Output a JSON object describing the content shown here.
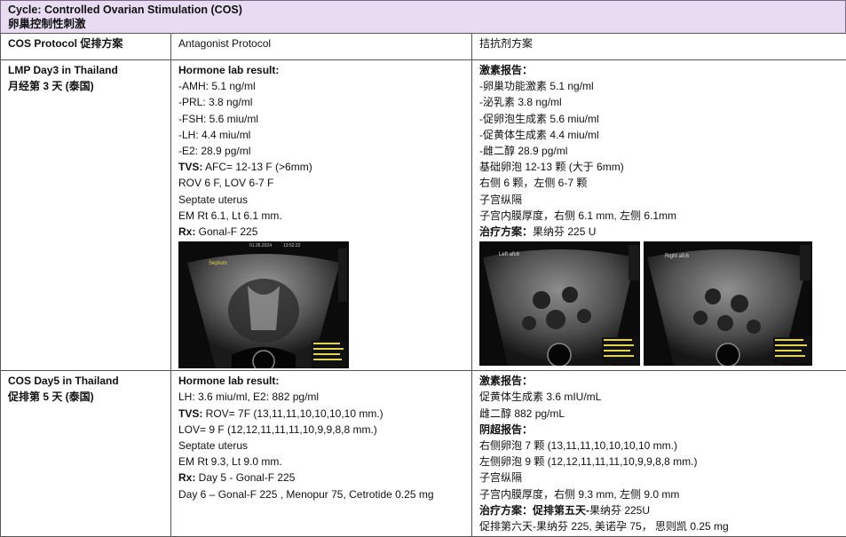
{
  "header": {
    "title_en": "Cycle: Controlled Ovarian Stimulation (COS)",
    "title_zh": "卵巢控制性刺激"
  },
  "rows": {
    "protocol": {
      "label": "COS Protocol 促排方案",
      "en": "Antagonist Protocol",
      "zh": "拮抗剂方案"
    },
    "day3": {
      "label_en": "LMP Day3 in Thailand",
      "label_zh": "月经第 3 天 (泰国)",
      "en_heading": "Hormone lab result:",
      "en_lines": [
        "-AMH: 5.1 ng/ml",
        "-PRL: 3.8 ng/ml",
        "-FSH: 5.6 miu/ml",
        "-LH: 4.4 miu/ml",
        "-E2: 28.9 pg/ml"
      ],
      "tvs_label": "TVS:",
      "tvs_text": " AFC= 12-13 F (>6mm)",
      "en_more": [
        "ROV 6 F, LOV 6-7 F",
        "Septate uterus",
        "EM Rt 6.1, Lt 6.1 mm."
      ],
      "rx_label": "Rx:",
      "rx_text": " Gonal-F 225",
      "zh_heading": "激素报告：",
      "zh_lines": [
        "-卵巢功能激素 5.1 ng/ml",
        "-泌乳素 3.8 ng/ml",
        "-促卵泡生成素 5.6 miu/ml",
        "-促黄体生成素 4.4 miu/ml",
        "-雌二醇 28.9 pg/ml",
        "基础卵泡 12-13 颗 (大于 6mm)",
        "右侧 6 颗，左侧 6-7 颗",
        "子宫纵隔",
        "子宫内膜厚度，右侧 6.1 mm, 左侧 6.1mm"
      ],
      "zh_rx_label": "治疗方案：",
      "zh_rx_text": "果纳芬 225 U",
      "us1_label": "Septum",
      "us1_date": "01.05.2024",
      "us1_time": "13:52:22",
      "us2_label": "Left afc6",
      "us3_label": "Right afc6"
    },
    "day5": {
      "label_en": "COS Day5 in Thailand",
      "label_zh": "促排第 5 天 (泰国)",
      "en_heading": "Hormone lab result:",
      "en_line1": "LH: 3.6 miu/ml, E2: 882 pg/ml",
      "tvs_label": "TVS:",
      "tvs_text": " ROV= 7F (13,11,11,10,10,10,10 mm.)",
      "en_more": [
        "LOV= 9 F (12,12,11,11,11,10,9,9,8,8 mm.)",
        "Septate uterus",
        "EM Rt 9.3, Lt 9.0 mm."
      ],
      "rx_label": "Rx:",
      "rx_text": " Day 5 - Gonal-F 225",
      "en_last": "Day 6 – Gonal-F 225 , Menopur 75, Cetrotide 0.25 mg",
      "zh_heading": "激素报告：",
      "zh_lines1": [
        "促黄体生成素 3.6 mIU/mL",
        "雌二醇 882 pg/mL"
      ],
      "zh_us_heading": "阴超报告：",
      "zh_lines2": [
        "右侧卵泡 7 颗 (13,11,11,10,10,10,10 mm.)",
        "左侧卵泡 9 颗 (12,12,11,11,11,10,9,9,8,8 mm.)",
        "子宫纵隔",
        "子宫内膜厚度，右侧 9.3 mm, 左侧 9.0 mm"
      ],
      "zh_rx_label": "治疗方案：促排第五天-",
      "zh_rx_text": "果纳芬 225U",
      "zh_last": "促排第六天-果纳芬 225, 美诺孕 75，  思则凯 0.25 mg"
    }
  },
  "colors": {
    "header_bg": "#e8dcf2",
    "ultrasound_bg": "#0b0b0b"
  }
}
